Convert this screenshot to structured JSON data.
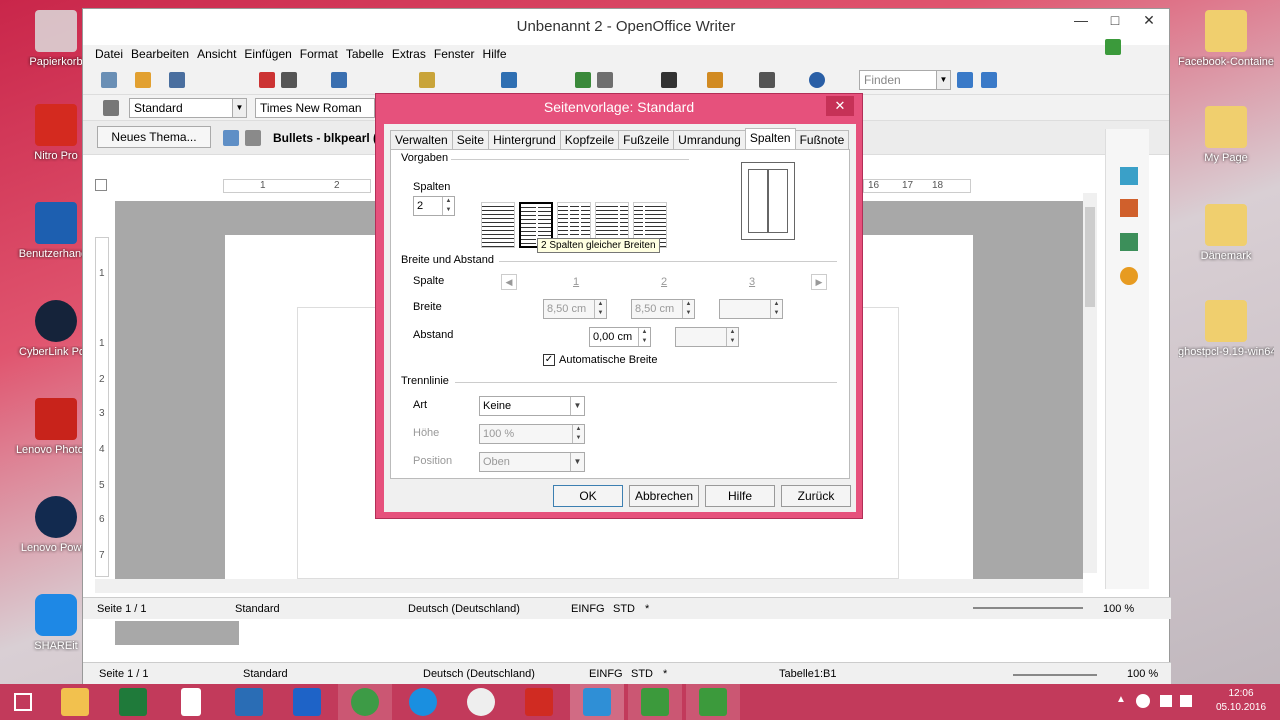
{
  "desktop": {
    "icons_left": [
      {
        "label": "Papierkorb",
        "icon": "recycle-bin-icon",
        "color": "#dcdcdc"
      },
      {
        "label": "Nitro Pro",
        "icon": "nitro-pro-icon",
        "color": "#d42a1f"
      },
      {
        "label": "Benutzerhandb",
        "icon": "lenovo-manual-icon",
        "color": "#1d5fb0"
      },
      {
        "label": "CyberLink Pow",
        "icon": "cyberlink-icon",
        "color": "#15233a"
      },
      {
        "label": "Lenovo Photo M",
        "icon": "lenovo-photo-icon",
        "color": "#c8231b"
      },
      {
        "label": "Lenovo Power",
        "icon": "lenovo-power-icon",
        "color": "#122a4f"
      },
      {
        "label": "SHAREit",
        "icon": "shareit-icon",
        "color": "#1e88e5"
      }
    ],
    "icons_right": [
      {
        "label": "Facebook-Container",
        "icon": "folder-icon"
      },
      {
        "label": "My Page",
        "icon": "folder-icon"
      },
      {
        "label": "Dänemark",
        "icon": "folder-icon"
      },
      {
        "label": "ghostpcl-9.19-win64",
        "icon": "zip-folder-icon"
      }
    ]
  },
  "writer": {
    "title": "Unbenannt 2 - OpenOffice Writer",
    "menu": [
      "Datei",
      "Bearbeiten",
      "Ansicht",
      "Einfügen",
      "Format",
      "Tabelle",
      "Extras",
      "Fenster",
      "Hilfe"
    ],
    "find_placeholder": "Finden",
    "style_value": "Standard",
    "font_value": "Times New Roman",
    "new_theme_label": "Neues Thema...",
    "bullets_label": "Bullets - blkpearl (C:",
    "ruler_numbers": [
      "1",
      "2",
      "16",
      "17",
      "18"
    ],
    "vruler_numbers": [
      "1",
      "1",
      "2",
      "3",
      "4",
      "5",
      "6",
      "7"
    ],
    "status_inner": {
      "page": "Seite 1 / 1",
      "style": "Standard",
      "lang": "Deutsch (Deutschland)",
      "mode": "EINFG",
      "sel": "STD",
      "mod": "*",
      "zoom": "100 %"
    },
    "status_outer": {
      "page": "Seite 1 / 1",
      "style": "Standard",
      "lang": "Deutsch (Deutschland)",
      "mode": "EINFG",
      "sel": "STD",
      "mod": "*",
      "cell": "Tabelle1:B1",
      "zoom": "100 %"
    }
  },
  "dialog": {
    "title": "Seitenvorlage: Standard",
    "tabs": [
      "Verwalten",
      "Seite",
      "Hintergrund",
      "Kopfzeile",
      "Fußzeile",
      "Umrandung",
      "Spalten",
      "Fußnote"
    ],
    "active_tab": "Spalten",
    "vorgaben": {
      "section": "Vorgaben",
      "columns_label": "Spalten",
      "columns_value": "2",
      "preset_count": 5,
      "selected_preset": 2,
      "tooltip": "2 Spalten gleicher Breiten"
    },
    "breite": {
      "section": "Breite und Abstand",
      "spalte_label": "Spalte",
      "col_numbers": [
        "1",
        "2",
        "3"
      ],
      "breite_label": "Breite",
      "breite_values": [
        "8,50 cm",
        "8,50 cm",
        ""
      ],
      "abstand_label": "Abstand",
      "abstand_values": [
        "0,00 cm",
        ""
      ],
      "auto_label": "Automatische Breite",
      "auto_checked": true
    },
    "trennlinie": {
      "section": "Trennlinie",
      "art_label": "Art",
      "art_value": "Keine",
      "hoehe_label": "Höhe",
      "hoehe_value": "100 %",
      "position_label": "Position",
      "position_value": "Oben"
    },
    "buttons": {
      "ok": "OK",
      "cancel": "Abbrechen",
      "help": "Hilfe",
      "reset": "Zurück"
    }
  },
  "taskbar": {
    "time": "12:06",
    "date": "05.10.2016",
    "apps": [
      {
        "icon": "file-explorer-icon",
        "color": "#f2c14e"
      },
      {
        "icon": "excel-icon",
        "color": "#1f7a3a"
      },
      {
        "icon": "document-icon",
        "color": "#ffffff"
      },
      {
        "icon": "monitor-icon",
        "color": "#2a6db5"
      },
      {
        "icon": "m-app-icon",
        "color": "#1e63c7"
      },
      {
        "icon": "chrome-icon",
        "color": "#3d9b46"
      },
      {
        "icon": "internet-explorer-icon",
        "color": "#1a8fe0"
      },
      {
        "icon": "circle-app-icon",
        "color": "#eeeeee"
      },
      {
        "icon": "nitro-icon",
        "color": "#d02b22"
      },
      {
        "icon": "openoffice-icon",
        "color": "#2f8fd6"
      },
      {
        "icon": "camtasia-icon",
        "color": "#3c9a3c"
      },
      {
        "icon": "camtasia-recorder-icon",
        "color": "#3c9a3c"
      }
    ]
  }
}
